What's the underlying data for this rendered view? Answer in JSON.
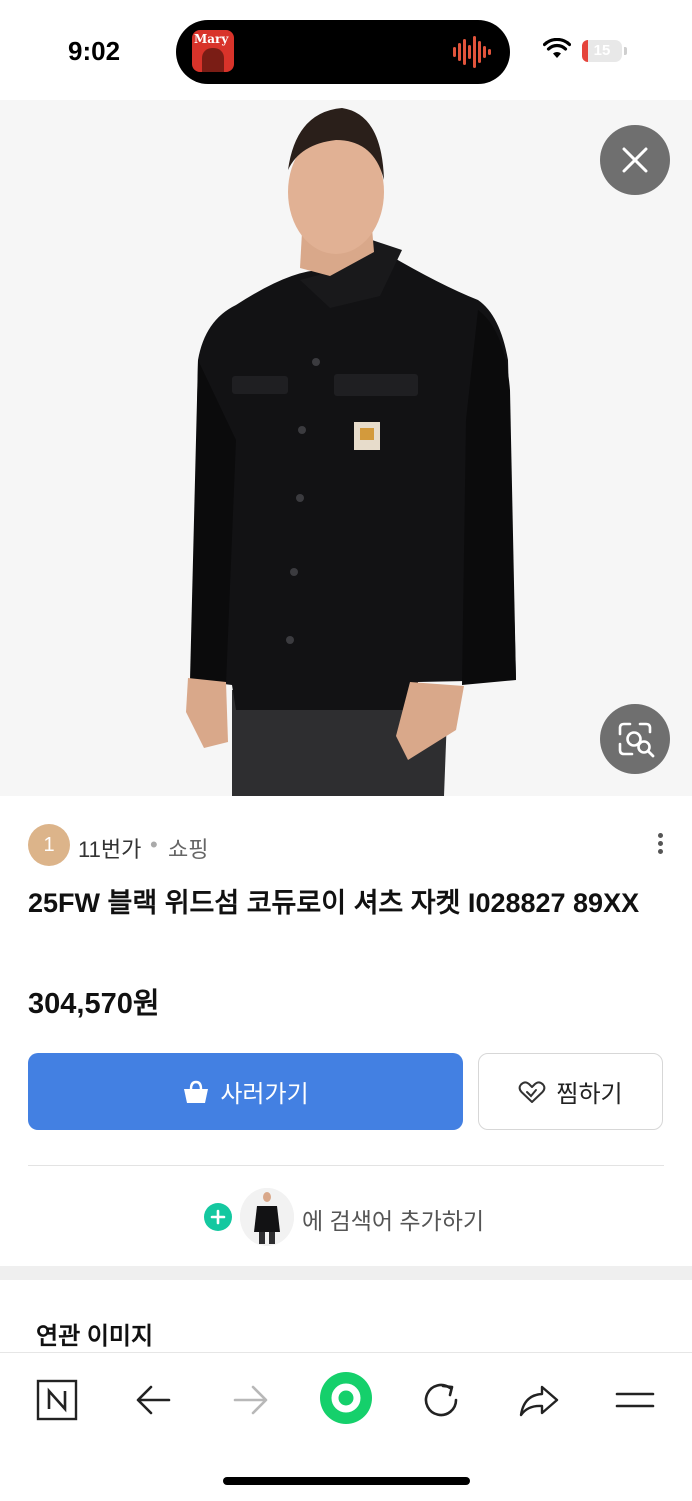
{
  "status_bar": {
    "time": "9:02",
    "battery": "15",
    "battery_level": 0.15,
    "now_playing_art_text": "Mary",
    "icons": [
      "wifi-icon",
      "battery-icon",
      "waveform-icon"
    ]
  },
  "image_viewer": {
    "close_icon": "close-icon",
    "lens_icon": "image-search-icon"
  },
  "product": {
    "source_badge": "1",
    "source_name": "11번가",
    "source_separator": "•",
    "source_category": "쇼핑",
    "title": "25FW 블랙 위드섬 코듀로이 셔츠 자켓 I028827 89XX",
    "price": "304,570원"
  },
  "actions": {
    "buy_label": "사러가기",
    "save_label": "찜하기",
    "add_keyword_label": "에 검색어 추가하기"
  },
  "related": {
    "title": "연관 이미지"
  },
  "bottom_nav": {
    "items": [
      "naver-home-icon",
      "back-arrow-icon",
      "forward-arrow-icon",
      "green-dot-icon",
      "refresh-icon",
      "share-icon",
      "menu-icon"
    ]
  },
  "colors": {
    "buy_button": "#4380e2",
    "plus_badge": "#14c8a0",
    "green_dot": "#15d06b",
    "battery_red": "#e5443b"
  }
}
